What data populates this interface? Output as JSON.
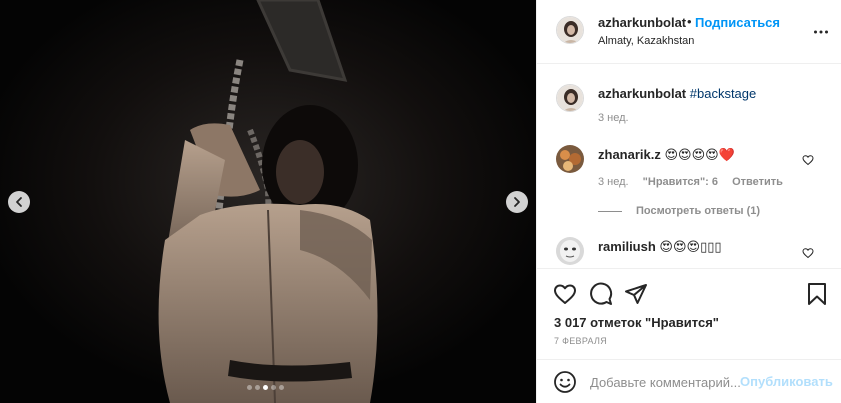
{
  "post": {
    "username": "azharkunbolat",
    "follow_label": "Подписаться",
    "separator": "•",
    "location": "Almaty, Kazakhstan",
    "more_icon": "more-horizontal-icon"
  },
  "carousel": {
    "prev_icon": "chevron-left-icon",
    "next_icon": "chevron-right-icon",
    "slide_count": 5,
    "active_index": 2
  },
  "comments": [
    {
      "username": "azharkunbolat",
      "text": "#backstage",
      "time": "3 нед."
    },
    {
      "username": "zhanarik.z",
      "text": "😍😍😍😍❤️",
      "time": "3 нед.",
      "likes": "\"Нравится\": 6",
      "reply_label": "Ответить",
      "view_replies": "Посмотреть ответы (1)"
    },
    {
      "username": "ramiliush",
      "text": "😍😍😍▯▯▯"
    }
  ],
  "actions": {
    "likes_text": "3 017 отметок \"Нравится\"",
    "date": "7 ФЕВРАЛЯ"
  },
  "composer": {
    "placeholder": "Добавьте комментарий...",
    "post_label": "Опубликовать"
  },
  "colors": {
    "accent": "#0095f6",
    "post_disabled": "#b2dffc",
    "secondary_text": "#8e8e8e"
  }
}
